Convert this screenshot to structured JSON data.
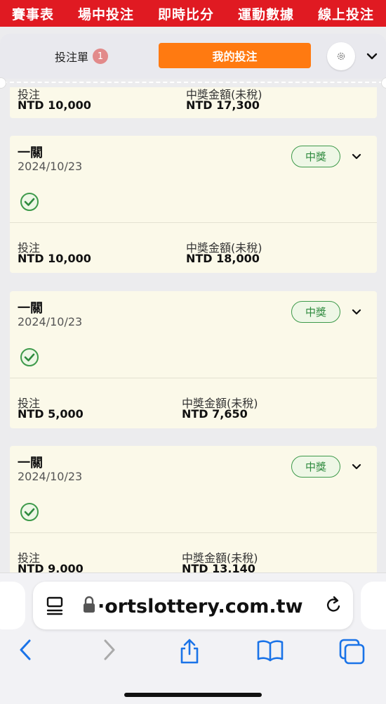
{
  "topnav": {
    "items": [
      "賽事表",
      "場中投注",
      "即時比分",
      "運動數據",
      "線上投注"
    ]
  },
  "header": {
    "bet_slip_label": "投注單",
    "bet_slip_count": "1",
    "my_bets_label": "我的投注"
  },
  "partial_card": {
    "stake_label": "投注",
    "stake_value": "NTD 10,000",
    "payout_label": "中獎金額(未稅)",
    "payout_value": "NTD 17,300"
  },
  "bets": [
    {
      "title": "一關",
      "date": "2024/10/23",
      "status": "中獎",
      "stake_label": "投注",
      "stake_value": "NTD 10,000",
      "payout_label": "中獎金額(未稅)",
      "payout_value": "NTD 18,000"
    },
    {
      "title": "一關",
      "date": "2024/10/23",
      "status": "中獎",
      "stake_label": "投注",
      "stake_value": "NTD 5,000",
      "payout_label": "中獎金額(未稅)",
      "payout_value": "NTD 7,650"
    },
    {
      "title": "一關",
      "date": "2024/10/23",
      "status": "中獎",
      "stake_label": "投注",
      "stake_value": "NTD 9,000",
      "payout_label": "中獎金額(未稅)",
      "payout_value": "NTD 13,140"
    }
  ],
  "browser": {
    "url_visible": "·ortslottery.com.tw"
  },
  "colors": {
    "nav_red": "#e01a22",
    "accent_orange": "#ff7a11",
    "win_green": "#3e9a4b",
    "card_bg": "#fbf9e9"
  }
}
